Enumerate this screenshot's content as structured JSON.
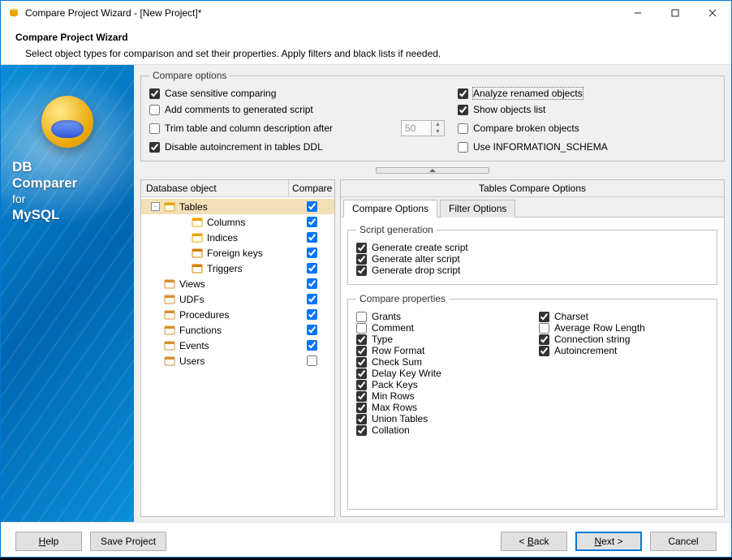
{
  "window": {
    "title": "Compare Project Wizard - [New Project]*",
    "header_title": "Compare Project Wizard",
    "header_sub": "Select object types for comparison and set their properties. Apply filters and black lists if needed."
  },
  "brand": {
    "line1": "DB",
    "line2": "Comparer",
    "for": "for",
    "line3": "MySQL"
  },
  "compare_options": {
    "legend": "Compare options",
    "left": [
      {
        "label": "Case sensitive comparing",
        "checked": true
      },
      {
        "label": "Add comments to generated script",
        "checked": false
      },
      {
        "label": "Trim table and column description after",
        "checked": false
      },
      {
        "label": "Disable autoincrement in tables DDL",
        "checked": true
      }
    ],
    "trim_value": "50",
    "right": [
      {
        "label": "Analyze renamed objects",
        "checked": true,
        "focus": true
      },
      {
        "label": "Show objects list",
        "checked": true
      },
      {
        "label": "Compare broken objects",
        "checked": false
      },
      {
        "label": "Use INFORMATION_SCHEMA",
        "checked": false
      }
    ]
  },
  "tree": {
    "col1": "Database object",
    "col2": "Compare",
    "items": [
      {
        "label": "Tables",
        "depth": 0,
        "exp": "-",
        "icon": "table",
        "checked": true,
        "selected": true
      },
      {
        "label": "Columns",
        "depth": 1,
        "exp": "",
        "icon": "columns",
        "checked": true
      },
      {
        "label": "Indices",
        "depth": 1,
        "exp": "",
        "icon": "index",
        "checked": true
      },
      {
        "label": "Foreign keys",
        "depth": 1,
        "exp": "",
        "icon": "fk",
        "checked": true
      },
      {
        "label": "Triggers",
        "depth": 1,
        "exp": "",
        "icon": "trigger",
        "checked": true
      },
      {
        "label": "Views",
        "depth": 0,
        "exp": "",
        "icon": "view",
        "checked": true
      },
      {
        "label": "UDFs",
        "depth": 0,
        "exp": "",
        "icon": "udf",
        "checked": true
      },
      {
        "label": "Procedures",
        "depth": 0,
        "exp": "",
        "icon": "proc",
        "checked": true
      },
      {
        "label": "Functions",
        "depth": 0,
        "exp": "",
        "icon": "func",
        "checked": true
      },
      {
        "label": "Events",
        "depth": 0,
        "exp": "",
        "icon": "event",
        "checked": true
      },
      {
        "label": "Users",
        "depth": 0,
        "exp": "",
        "icon": "user",
        "checked": false
      }
    ]
  },
  "right_panel": {
    "title": "Tables Compare Options",
    "tabs": [
      {
        "label": "Compare Options",
        "active": true
      },
      {
        "label": "Filter Options",
        "active": false
      }
    ],
    "script_gen": {
      "legend": "Script generation",
      "items": [
        {
          "label": "Generate create script",
          "checked": true
        },
        {
          "label": "Generate alter script",
          "checked": true
        },
        {
          "label": "Generate drop script",
          "checked": true
        }
      ]
    },
    "compare_props": {
      "legend": "Compare properties",
      "left": [
        {
          "label": "Grants",
          "checked": false
        },
        {
          "label": "Comment",
          "checked": false
        },
        {
          "label": "Type",
          "checked": true
        },
        {
          "label": "Row Format",
          "checked": true
        },
        {
          "label": "Check Sum",
          "checked": true
        },
        {
          "label": "Delay Key Write",
          "checked": true
        },
        {
          "label": "Pack Keys",
          "checked": true
        },
        {
          "label": "Min Rows",
          "checked": true
        },
        {
          "label": "Max Rows",
          "checked": true
        },
        {
          "label": "Union Tables",
          "checked": true
        },
        {
          "label": "Collation",
          "checked": true
        }
      ],
      "right": [
        {
          "label": "Charset",
          "checked": true
        },
        {
          "label": "Average Row Length",
          "checked": false
        },
        {
          "label": "Connection string",
          "checked": true
        },
        {
          "label": "Autoincrement",
          "checked": true
        }
      ]
    }
  },
  "footer": {
    "help": "Help",
    "save": "Save Project",
    "back": "< Back",
    "next": "Next >",
    "cancel": "Cancel"
  }
}
